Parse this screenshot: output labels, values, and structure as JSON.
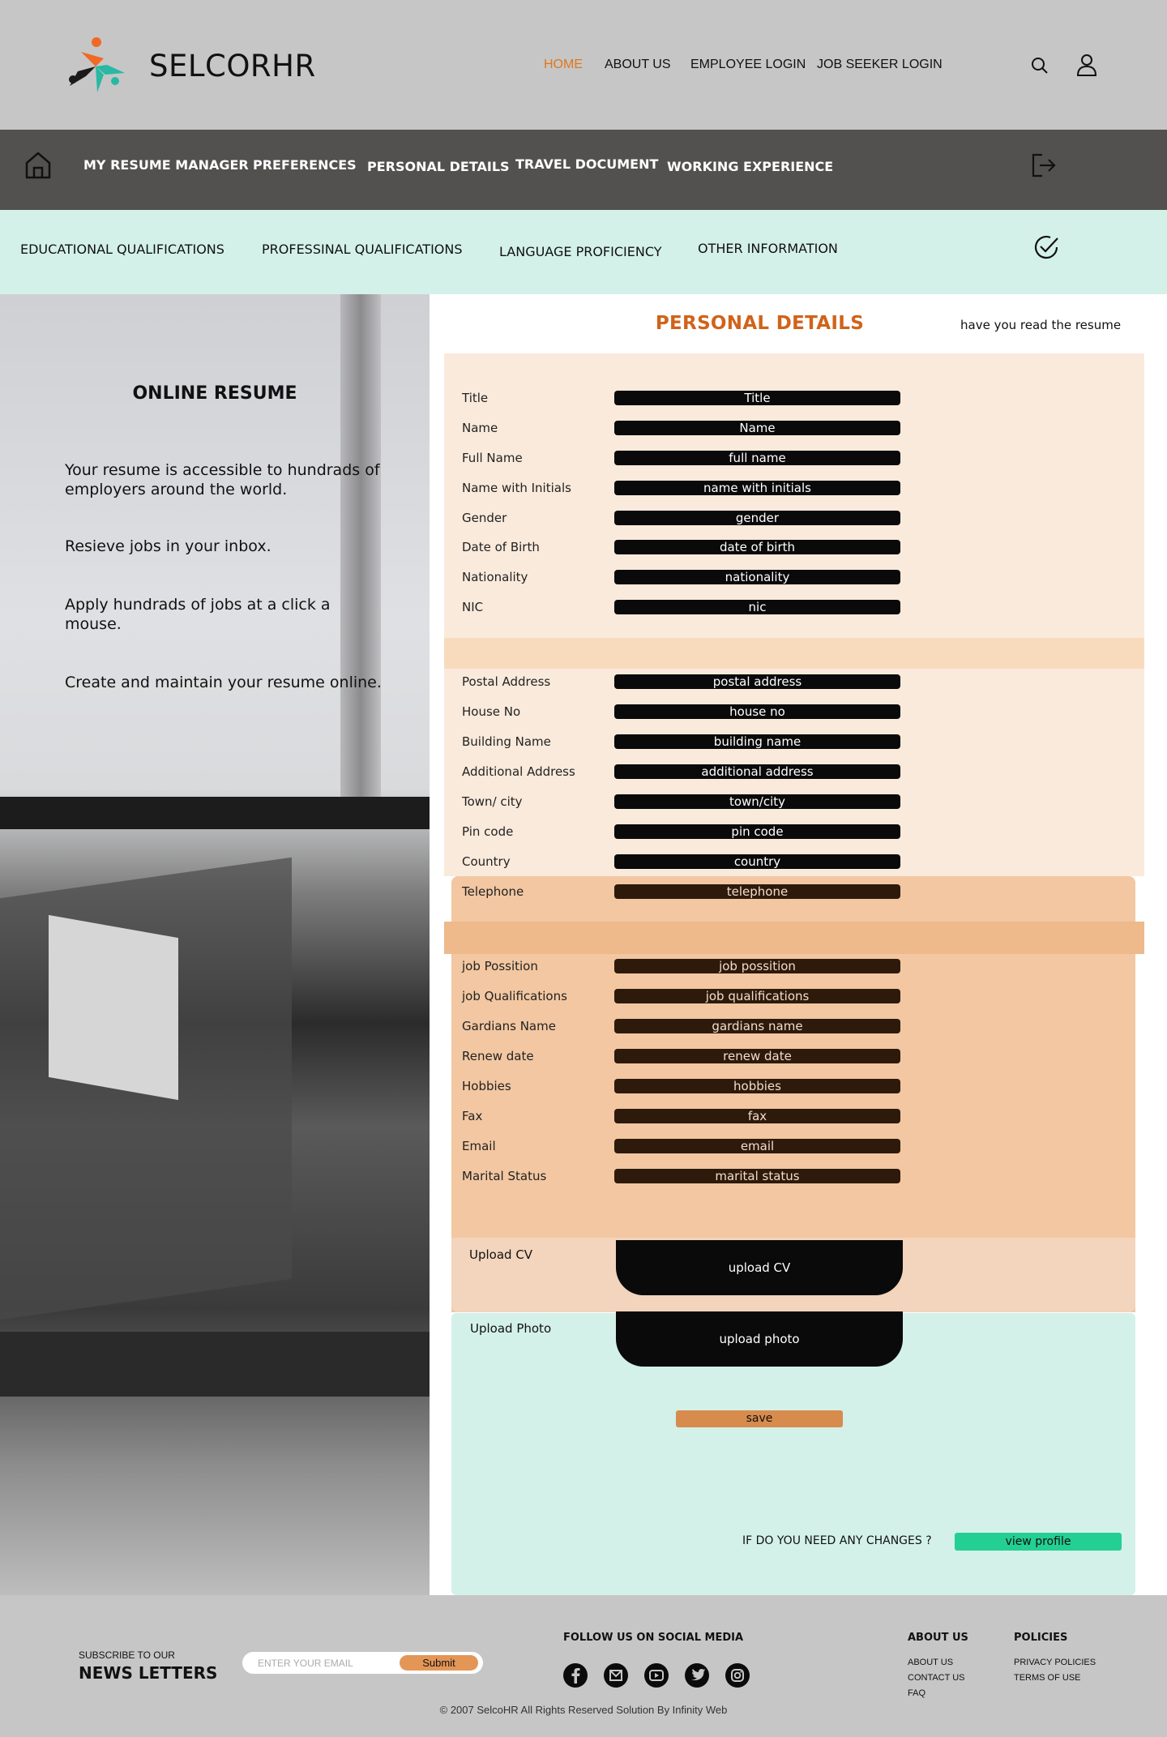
{
  "brand": {
    "name": "SELCORHR"
  },
  "top_nav": [
    "HOME",
    "ABOUT US",
    "EMPLOYEE LOGIN",
    "JOB SEEKER LOGIN"
  ],
  "main_nav": [
    "MY RESUME MANAGER",
    "PREFERENCES",
    "PERSONAL DETAILS",
    "TRAVEL DOCUMENT",
    "WORKING EXPERIENCE"
  ],
  "sub_nav": [
    "EDUCATIONAL QUALIFICATIONS",
    "PROFESSINAL QUALIFICATIONS",
    "LANGUAGE PROFICIENCY",
    "OTHER INFORMATION"
  ],
  "left_panel": {
    "title": "ONLINE RESUME",
    "points": [
      "Your resume is accessible to hundrads of employers around the world.",
      "Resieve jobs in your inbox.",
      "Apply hundrads of jobs at a click a mouse.",
      "Create and maintain your resume online."
    ]
  },
  "form": {
    "title": "PERSONAL  DETAILS",
    "read_note": "have you read the resume",
    "personal": [
      {
        "label": "Title",
        "value": "Title"
      },
      {
        "label": "Name",
        "value": "Name"
      },
      {
        "label": "Full Name",
        "value": "full name"
      },
      {
        "label": "Name with Initials",
        "value": "name with initials"
      },
      {
        "label": "Gender",
        "value": "gender"
      },
      {
        "label": "Date of Birth",
        "value": "date of birth"
      },
      {
        "label": "Nationality",
        "value": "nationality"
      },
      {
        "label": "NIC",
        "value": "nic"
      }
    ],
    "address": [
      {
        "label": "Postal Address",
        "value": "postal address"
      },
      {
        "label": "House No",
        "value": "house no"
      },
      {
        "label": "Building Name",
        "value": "building name"
      },
      {
        "label": "Additional Address",
        "value": "additional address"
      },
      {
        "label": "Town/ city",
        "value": "town/city"
      },
      {
        "label": "Pin code",
        "value": "pin code"
      },
      {
        "label": "Country",
        "value": "country"
      },
      {
        "label": "Telephone",
        "value": "telephone"
      }
    ],
    "other": [
      {
        "label": "job Possition",
        "value": "job possition"
      },
      {
        "label": "job Qualifications",
        "value": "job qualifications"
      },
      {
        "label": "Gardians Name",
        "value": "gardians name"
      },
      {
        "label": "Renew date",
        "value": "renew date"
      },
      {
        "label": "Hobbies",
        "value": "hobbies"
      },
      {
        "label": "Fax",
        "value": "fax"
      },
      {
        "label": "Email",
        "value": "email"
      },
      {
        "label": "Marital Status",
        "value": "marital status"
      }
    ],
    "upload_cv_label": "Upload CV",
    "upload_cv_button": "upload CV",
    "upload_photo_label": "Upload  Photo",
    "upload_photo_button": "upload photo",
    "save": "save",
    "changes_prompt": "IF DO YOU NEED ANY CHANGES ?",
    "view_profile": "view profile"
  },
  "footer": {
    "subscribe_small": "SUBSCRIBE TO OUR",
    "subscribe_big": "NEWS LETTERS",
    "email_placeholder": "ENTER YOUR EMAIL",
    "submit": "Submit",
    "follow": "FOLLOW US ON SOCIAL MEDIA",
    "social_icons": [
      "facebook-icon",
      "gmail-icon",
      "youtube-icon",
      "twitter-icon",
      "instagram-icon"
    ],
    "about_head": "ABOUT US",
    "about_links": [
      "ABOUT US",
      "CONTACT US",
      "FAQ"
    ],
    "policies_head": "POLICIES",
    "policies_links": [
      "PRIVACY POLICIES",
      "TERMS OF  USE"
    ],
    "copyright": "© 2007 SelcoHR All Rights Reserved Solution By Infinity Web"
  },
  "colors": {
    "accent_orange": "#d0631a",
    "header_gray": "#c6c6c6",
    "nav_dark": "#535050",
    "mint": "#d3f1e8",
    "view_green": "#24cf93"
  }
}
